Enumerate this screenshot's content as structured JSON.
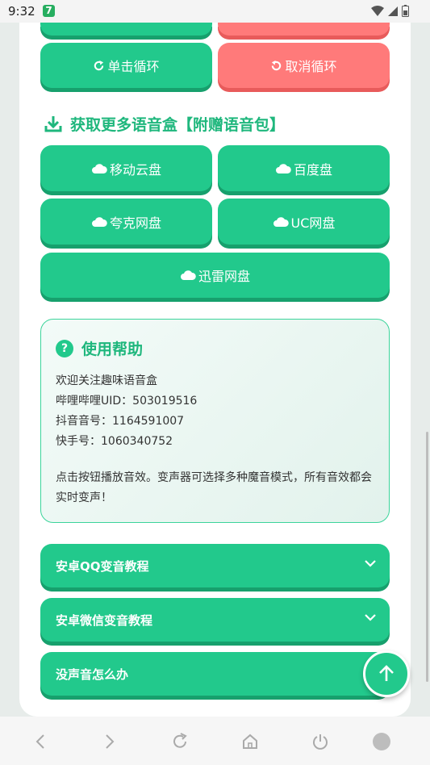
{
  "status": {
    "time": "9:32",
    "app_badge": "7"
  },
  "loop_buttons": {
    "single": "单击循环",
    "cancel": "取消循环"
  },
  "download_section": {
    "title": "获取更多语音盒【附赠语音包】",
    "buttons": [
      "移动云盘",
      "百度盘",
      "夸克网盘",
      "UC网盘",
      "迅雷网盘"
    ]
  },
  "help": {
    "title": "使用帮助",
    "lines": [
      "欢迎关注趣味语音盒",
      "哔哩哔哩UID：503019516",
      "抖音音号：1164591007",
      "快手号：1060340752"
    ],
    "paragraph": "点击按钮播放音效。变声器可选择多种魔音模式，所有音效都会实时变声！"
  },
  "accordions": [
    "安卓QQ变音教程",
    "安卓微信变音教程",
    "没声音怎么办"
  ],
  "icons": {
    "loop": "repeat-icon",
    "cancel": "undo-icon",
    "download": "download-icon",
    "cloud": "cloud-icon",
    "help": "question-icon",
    "chevron": "chevron-down-icon",
    "top": "arrow-up-icon"
  },
  "colors": {
    "primary": "#22c98c",
    "primary_shadow": "#17a06d",
    "danger": "#ff7a7a",
    "title": "#1fb77d"
  }
}
